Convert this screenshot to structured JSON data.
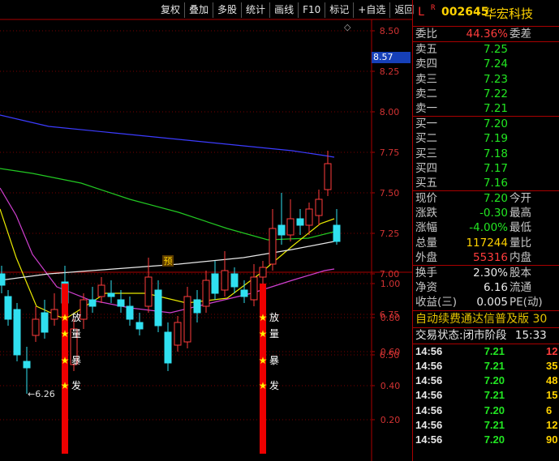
{
  "toolbar": [
    "复权",
    "叠加",
    "多股",
    "统计",
    "画线",
    "F10",
    "标记",
    "+自选",
    "返回"
  ],
  "price_tag": "8.57",
  "chart": {
    "price_axis": [
      "8.50",
      "8.25",
      "8.00",
      "7.75",
      "7.50",
      "7.25",
      "7.00",
      "6.75",
      "6.50"
    ],
    "low_label": "6.26",
    "pre_mark": "预",
    "indicator_axis": [
      "1.00",
      "0.80",
      "0.60",
      "0.40",
      "0.20"
    ],
    "signal_stars": [
      "放",
      "量",
      "暴",
      "发"
    ],
    "colors": {
      "up": "#ff3c3c",
      "down": "#30e0f0",
      "ma_blue": "#3c3cff",
      "ma_green": "#22c822",
      "ma_purple": "#d040d0",
      "ma_yellow": "#e8e800",
      "ma_white": "#e8e8e8",
      "signal": "#ee0000",
      "star": "#ffee00"
    }
  },
  "header": {
    "market": "L",
    "flag": "R",
    "code": "002645",
    "name": "华宏科技"
  },
  "weibi": {
    "label": "委比",
    "value": "44.36%",
    "label2": "委差"
  },
  "sells": [
    {
      "label": "卖五",
      "price": "7.25"
    },
    {
      "label": "卖四",
      "price": "7.24"
    },
    {
      "label": "卖三",
      "price": "7.23"
    },
    {
      "label": "卖二",
      "price": "7.22"
    },
    {
      "label": "卖一",
      "price": "7.21"
    }
  ],
  "buys": [
    {
      "label": "买一",
      "price": "7.20"
    },
    {
      "label": "买二",
      "price": "7.19"
    },
    {
      "label": "买三",
      "price": "7.18"
    },
    {
      "label": "买四",
      "price": "7.17"
    },
    {
      "label": "买五",
      "price": "7.16"
    }
  ],
  "quote": [
    {
      "l": "现价",
      "v": "7.20",
      "l2": "今开",
      "c": "green"
    },
    {
      "l": "涨跌",
      "v": "-0.30",
      "l2": "最高",
      "c": "green"
    },
    {
      "l": "涨幅",
      "v": "-4.00%",
      "l2": "最低",
      "c": "green"
    },
    {
      "l": "总量",
      "v": "117244",
      "l2": "量比",
      "c": "yellow"
    },
    {
      "l": "外盘",
      "v": "55316",
      "l2": "内盘",
      "c": "red"
    }
  ],
  "stats": [
    {
      "l": "换手",
      "v": "2.30%",
      "l2": "股本"
    },
    {
      "l": "净资",
      "v": "6.16",
      "l2": "流通"
    },
    {
      "l": "收益(三)",
      "v": "0.005",
      "l2": "PE(动)"
    }
  ],
  "ticker": "自动续费通达信普及版 30",
  "status": {
    "label": "交易状态:",
    "value": "闭市阶段",
    "time": "15:33"
  },
  "trades": [
    {
      "time": "14:56",
      "price": "7.21",
      "vol": "12",
      "c": "red"
    },
    {
      "time": "14:56",
      "price": "7.21",
      "vol": "35",
      "c": "yellow"
    },
    {
      "time": "14:56",
      "price": "7.20",
      "vol": "48",
      "c": "yellow"
    },
    {
      "time": "14:56",
      "price": "7.21",
      "vol": "15",
      "c": "yellow"
    },
    {
      "time": "14:56",
      "price": "7.20",
      "vol": "6",
      "c": "yellow"
    },
    {
      "time": "14:56",
      "price": "7.21",
      "vol": "12",
      "c": "yellow"
    },
    {
      "time": "14:56",
      "price": "7.20",
      "vol": "90",
      "c": "yellow"
    }
  ]
}
